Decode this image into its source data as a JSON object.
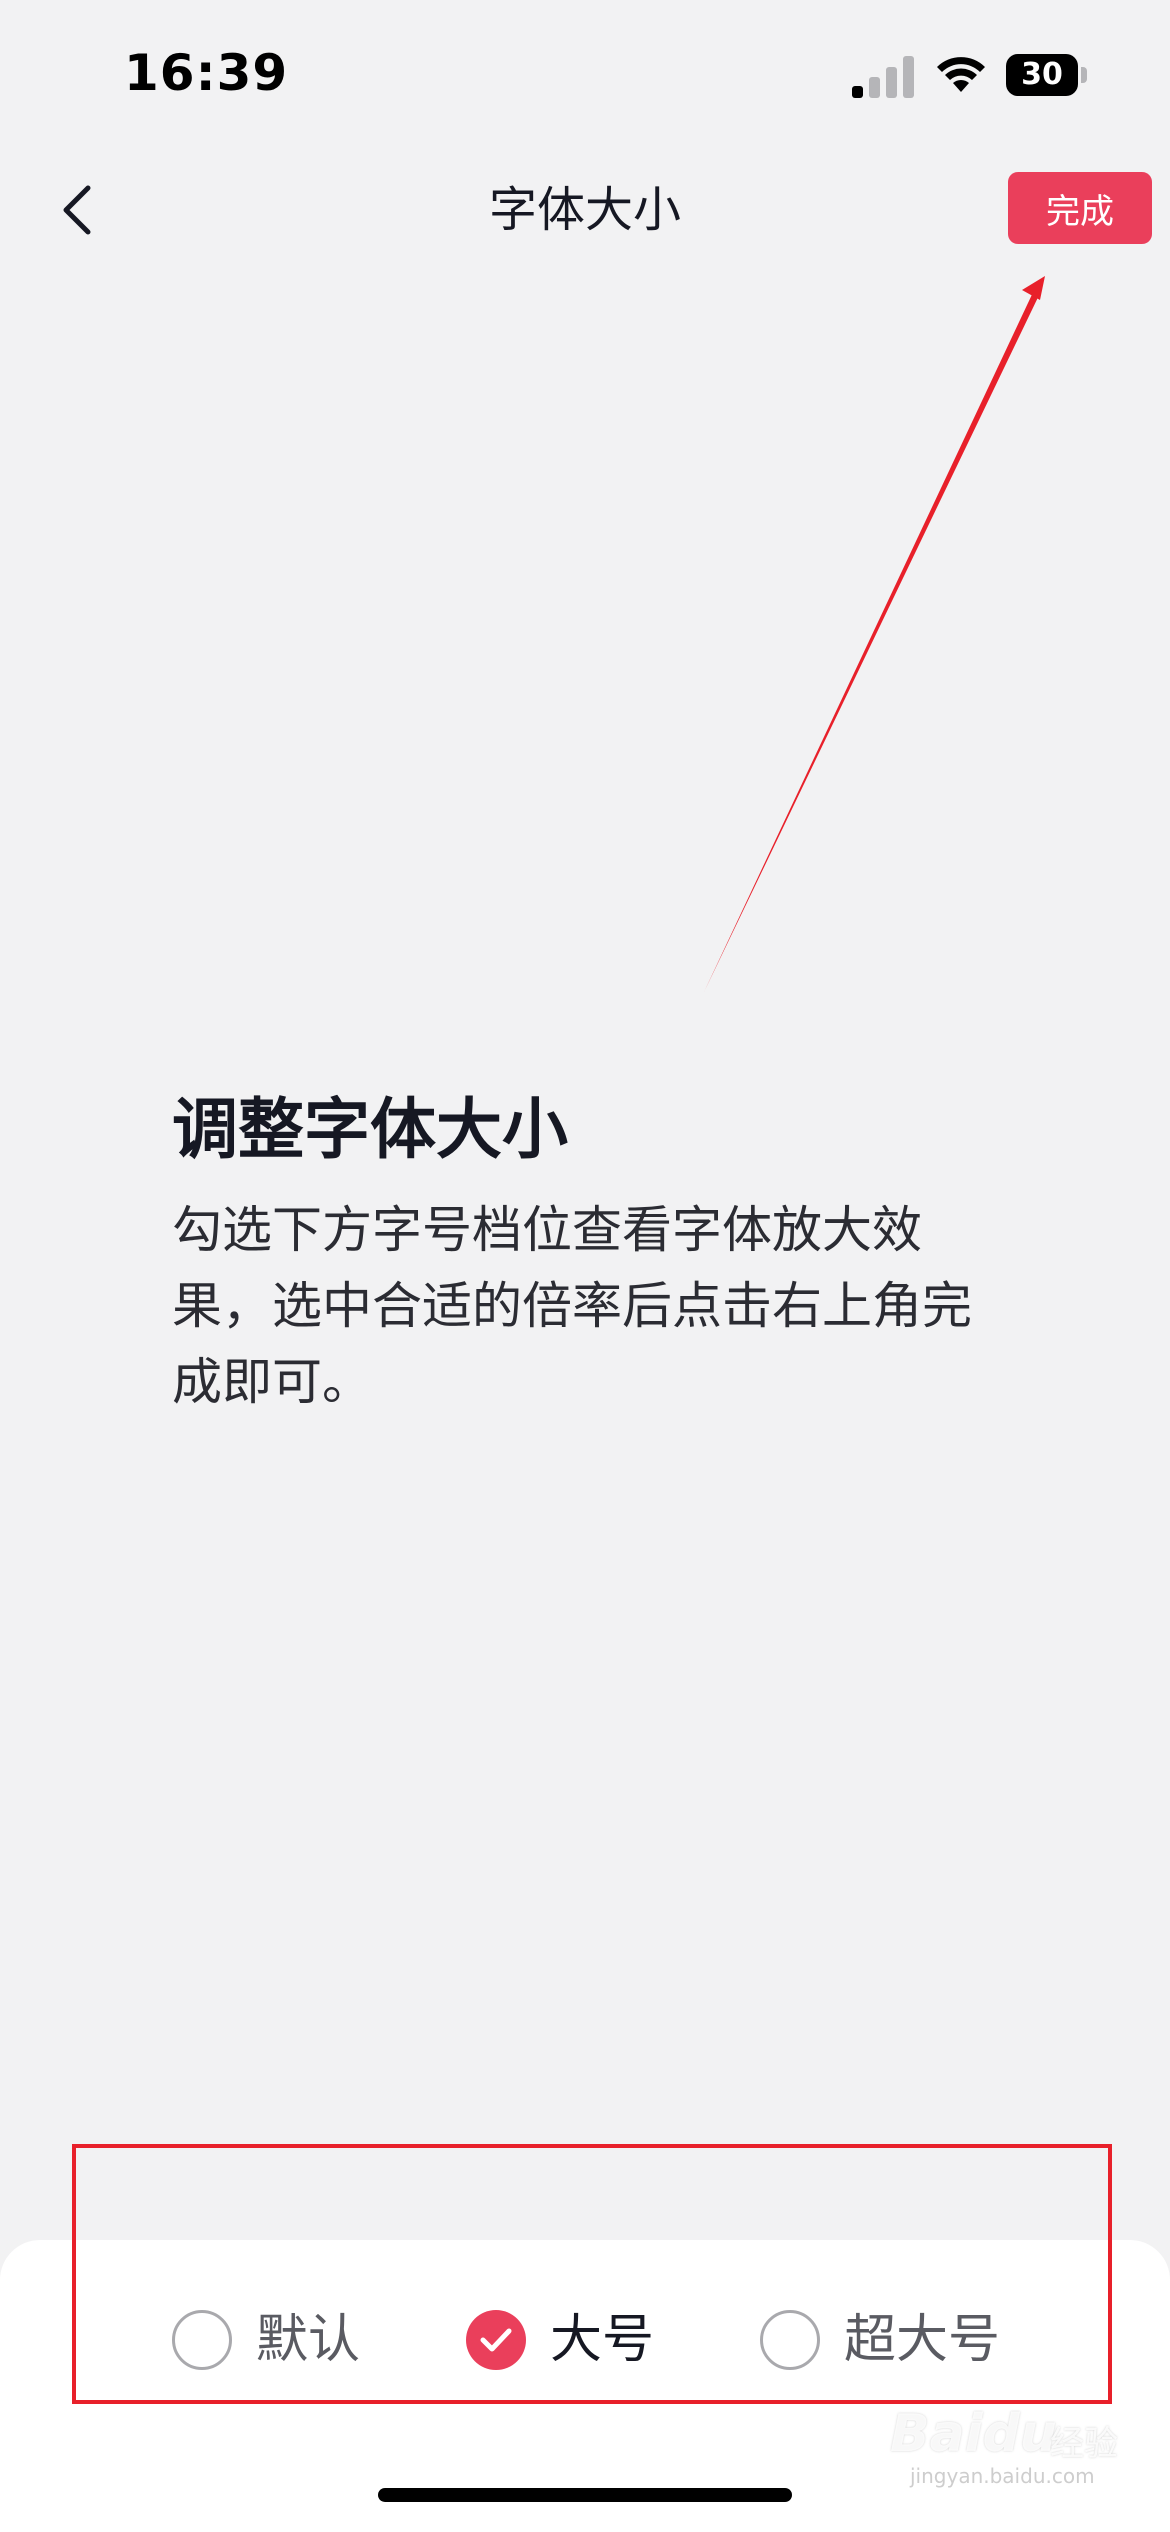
{
  "status_bar": {
    "time": "16:39",
    "battery_level": "30"
  },
  "nav": {
    "title": "字体大小",
    "done_label": "完成"
  },
  "intro": {
    "title": "调整字体大小",
    "description": "勾选下方字号档位查看字体放大效果，选中合适的倍率后点击右上角完成即可。"
  },
  "options": [
    {
      "label": "默认",
      "selected": false
    },
    {
      "label": "大号",
      "selected": true
    },
    {
      "label": "超大号",
      "selected": false
    }
  ],
  "watermark": {
    "brand": "Baidu",
    "suffix": "经验",
    "url": "jingyan.baidu.com"
  },
  "colors": {
    "accent": "#ea3f5b",
    "annotation": "#e8202a",
    "background": "#f2f2f3"
  }
}
